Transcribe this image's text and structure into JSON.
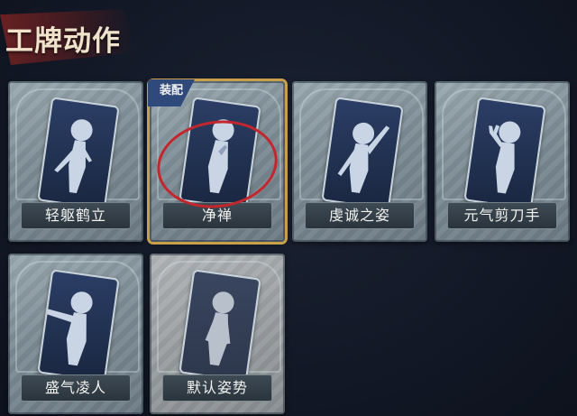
{
  "section": {
    "title": "工牌动作"
  },
  "cards": [
    {
      "name": "轻躯鹤立",
      "equipped": false
    },
    {
      "name": "净禅",
      "equipped": true,
      "badge": "装配"
    },
    {
      "name": "虔诚之姿",
      "equipped": false
    },
    {
      "name": "元气剪刀手",
      "equipped": false
    },
    {
      "name": "盛气凌人",
      "equipped": false
    },
    {
      "name": "默认姿势",
      "equipped": false
    }
  ],
  "colors": {
    "equipped_border": "#c9a04a",
    "highlight_ring": "#c3262d",
    "badge": "#2f4a7a"
  }
}
